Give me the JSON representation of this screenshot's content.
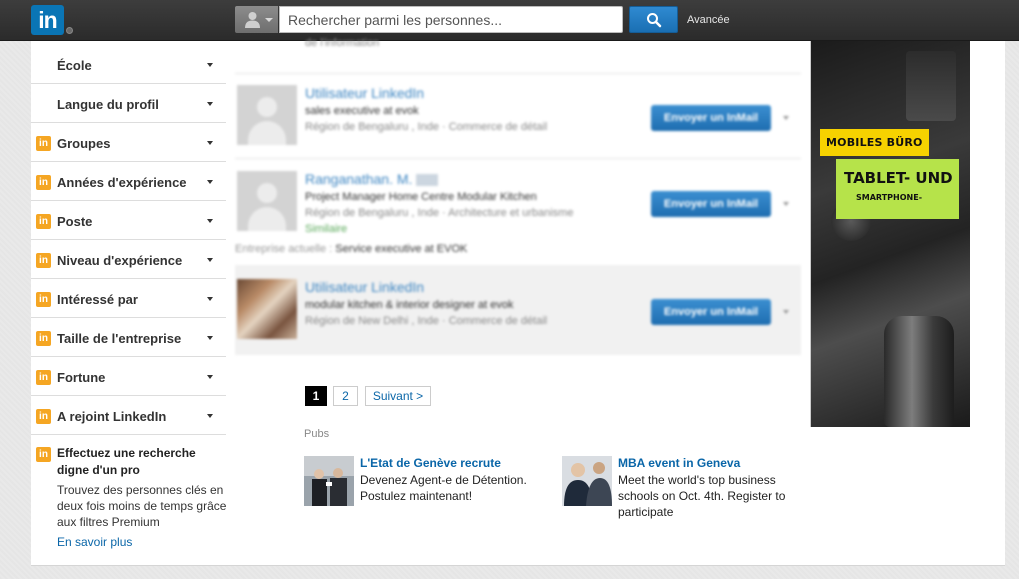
{
  "header": {
    "logo_text": "in",
    "search_placeholder": "Rechercher parmi les personnes...",
    "advanced_label": "Avancée"
  },
  "sidebar": {
    "facets": [
      {
        "label": "École",
        "premium": false
      },
      {
        "label": "Langue du profil",
        "premium": false
      },
      {
        "label": "Groupes",
        "premium": true
      },
      {
        "label": "Années d'expérience",
        "premium": true
      },
      {
        "label": "Poste",
        "premium": true
      },
      {
        "label": "Niveau d'expérience",
        "premium": true
      },
      {
        "label": "Intéressé par",
        "premium": true
      },
      {
        "label": "Taille de l'entreprise",
        "premium": true
      },
      {
        "label": "Fortune",
        "premium": true
      },
      {
        "label": "A rejoint LinkedIn",
        "premium": true
      }
    ],
    "premium_badge": "in",
    "premium_title": "Effectuez une recherche digne d'un pro",
    "premium_text": "Trouvez des personnes clés en deux fois moins de temps grâce aux filtres Premium",
    "premium_link": "En savoir plus"
  },
  "results": {
    "top_snippet": "de l'information",
    "items": [
      {
        "name": "Utilisateur LinkedIn",
        "headline": "sales executive at evok",
        "meta": "Région de Bengaluru , Inde · Commerce de détail",
        "button": "Envoyer un InMail"
      },
      {
        "name": "Ranganathan. M.",
        "headline": "Project Manager Home Centre Modular Kitchen",
        "meta": "Région de Bengaluru , Inde · Architecture et urbanisme",
        "extra": "Similaire",
        "current_label": "Entreprise actuelle :",
        "current_value": "Service executive at EVOK",
        "button": "Envoyer un InMail"
      },
      {
        "name": "Utilisateur LinkedIn",
        "headline": "modular kitchen & interior designer at evok",
        "meta": "Région de New Delhi , Inde · Commerce de détail",
        "button": "Envoyer un InMail"
      }
    ]
  },
  "pagination": {
    "pages": [
      "1",
      "2"
    ],
    "current": "1",
    "next_label": "Suivant >"
  },
  "ads": {
    "label": "Pubs",
    "items": [
      {
        "title": "L'Etat de Genève recrute",
        "body": "Devenez Agent-e de Détention. Postulez maintenant!"
      },
      {
        "title": "MBA event in Geneva",
        "body": "Meet the world's top business schools on Oct. 4th. Register to participate"
      }
    ]
  },
  "banner": {
    "tag1": "MOBILES BÜRO",
    "tag2_big": "TABLET- UND",
    "tag2_small": "SMARTPHONE-"
  },
  "colors": {
    "linkedin_blue": "#0a75b5",
    "premium_orange": "#f5a623",
    "link_blue": "#0a66a8"
  }
}
